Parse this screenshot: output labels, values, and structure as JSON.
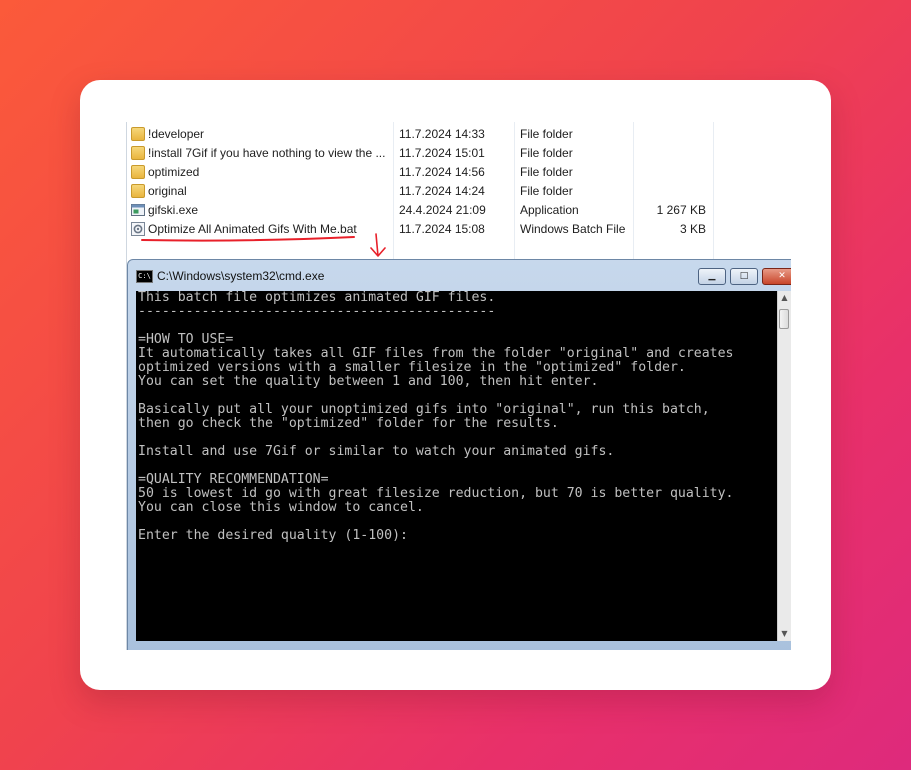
{
  "explorer": {
    "files": [
      {
        "name": "!developer",
        "date": "11.7.2024 14:33",
        "type": "File folder",
        "size": "",
        "icon": "folder-icon"
      },
      {
        "name": "!install 7Gif if you have nothing to view the ...",
        "date": "11.7.2024 15:01",
        "type": "File folder",
        "size": "",
        "icon": "folder-icon"
      },
      {
        "name": "optimized",
        "date": "11.7.2024 14:56",
        "type": "File folder",
        "size": "",
        "icon": "folder-icon"
      },
      {
        "name": "original",
        "date": "11.7.2024 14:24",
        "type": "File folder",
        "size": "",
        "icon": "folder-icon"
      },
      {
        "name": "gifski.exe",
        "date": "24.4.2024 21:09",
        "type": "Application",
        "size": "1 267 KB",
        "icon": "application-icon"
      },
      {
        "name": "Optimize All Animated Gifs With Me.bat",
        "date": "11.7.2024 15:08",
        "type": "Windows Batch File",
        "size": "3 KB",
        "icon": "batch-file-icon"
      }
    ]
  },
  "cmd": {
    "icon_label": "C:\\",
    "title": "C:\\Windows\\system32\\cmd.exe",
    "minimize_glyph": "▁",
    "maximize_glyph": "□",
    "close_glyph": "✕",
    "lines": [
      "This batch file optimizes animated GIF files.",
      "---------------------------------------------",
      "",
      "=HOW TO USE=",
      "It automatically takes all GIF files from the folder \"original\" and creates",
      "optimized versions with a smaller filesize in the \"optimized\" folder.",
      "You can set the quality between 1 and 100, then hit enter.",
      "",
      "Basically put all your unoptimized gifs into \"original\", run this batch,",
      "then go check the \"optimized\" folder for the results.",
      "",
      "Install and use 7Gif or similar to watch your animated gifs.",
      "",
      "=QUALITY RECOMMENDATION=",
      "50 is lowest id go with great filesize reduction, but 70 is better quality.",
      "You can close this window to cancel.",
      "",
      "Enter the desired quality (1-100):"
    ]
  },
  "colors": {
    "background_start": "#fb5a3a",
    "background_end": "#de2a7c",
    "annotation_red": "#e8202a",
    "console_text": "#c0c0c0"
  }
}
